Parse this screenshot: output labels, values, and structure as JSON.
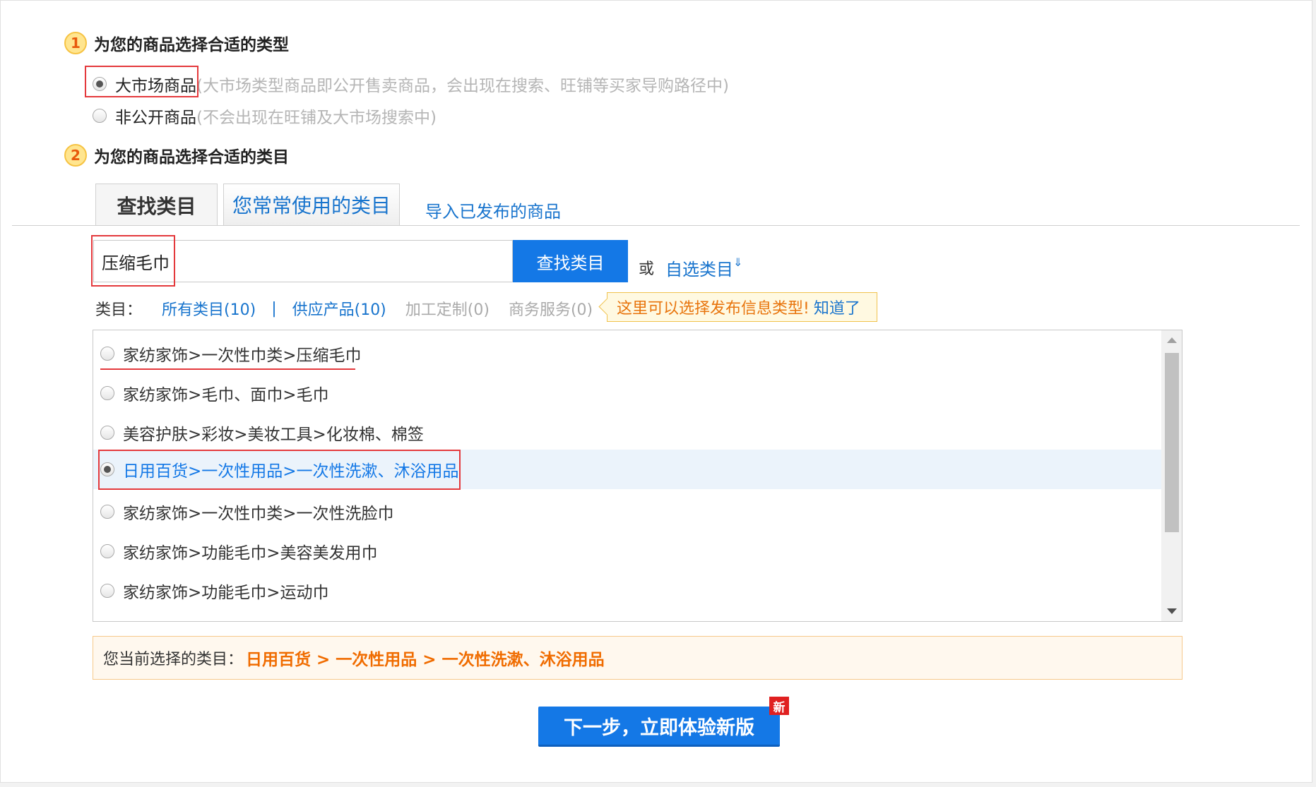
{
  "step1": {
    "number": "1",
    "title": "为您的商品选择合适的类型"
  },
  "product_types": [
    {
      "label": "大市场商品",
      "desc": "(大市场类型商品即公开售卖商品，会出现在搜索、旺铺等买家导购路径中)",
      "checked": true
    },
    {
      "label": "非公开商品",
      "desc": "(不会出现在旺铺及大市场搜索中)",
      "checked": false
    }
  ],
  "step2": {
    "number": "2",
    "title": "为您的商品选择合适的类目"
  },
  "tabs": {
    "find": "查找类目",
    "frequent": "您常常使用的类目",
    "import": "导入已发布的商品"
  },
  "search": {
    "value": "压缩毛巾",
    "button": "查找类目",
    "or": "或",
    "custom": "自选类目",
    "custom_icon": "chevron-double-down-icon"
  },
  "filters": {
    "label": "类目：",
    "all": "所有类目(10)",
    "separator": "|",
    "supply": "供应产品(10)",
    "custom": "加工定制(0)",
    "service": "商务服务(0)"
  },
  "tip": {
    "text": "这里可以选择发布信息类型!",
    "link": "知道了"
  },
  "categories": [
    {
      "text": "家纺家饰>一次性巾类>压缩毛巾",
      "checked": false
    },
    {
      "text": "家纺家饰>毛巾、面巾>毛巾",
      "checked": false
    },
    {
      "text": "美容护肤>彩妆>美妆工具>化妆棉、棉签",
      "checked": false
    },
    {
      "text": "日用百货>一次性用品>一次性洗漱、沐浴用品",
      "checked": true
    },
    {
      "text": "家纺家饰>一次性巾类>一次性洗脸巾",
      "checked": false
    },
    {
      "text": "家纺家饰>功能毛巾>美容美发用巾",
      "checked": false
    },
    {
      "text": "家纺家饰>功能毛巾>运动巾",
      "checked": false
    }
  ],
  "current": {
    "label": "您当前选择的类目：",
    "value": "日用百货 > 一次性用品 > 一次性洗漱、沐浴用品"
  },
  "next_button": {
    "label": "下一步，立即体验新版",
    "badge": "新"
  },
  "colors": {
    "accent": "#1478e6",
    "highlight": "#f06c00",
    "annotation": "#e4393c"
  }
}
